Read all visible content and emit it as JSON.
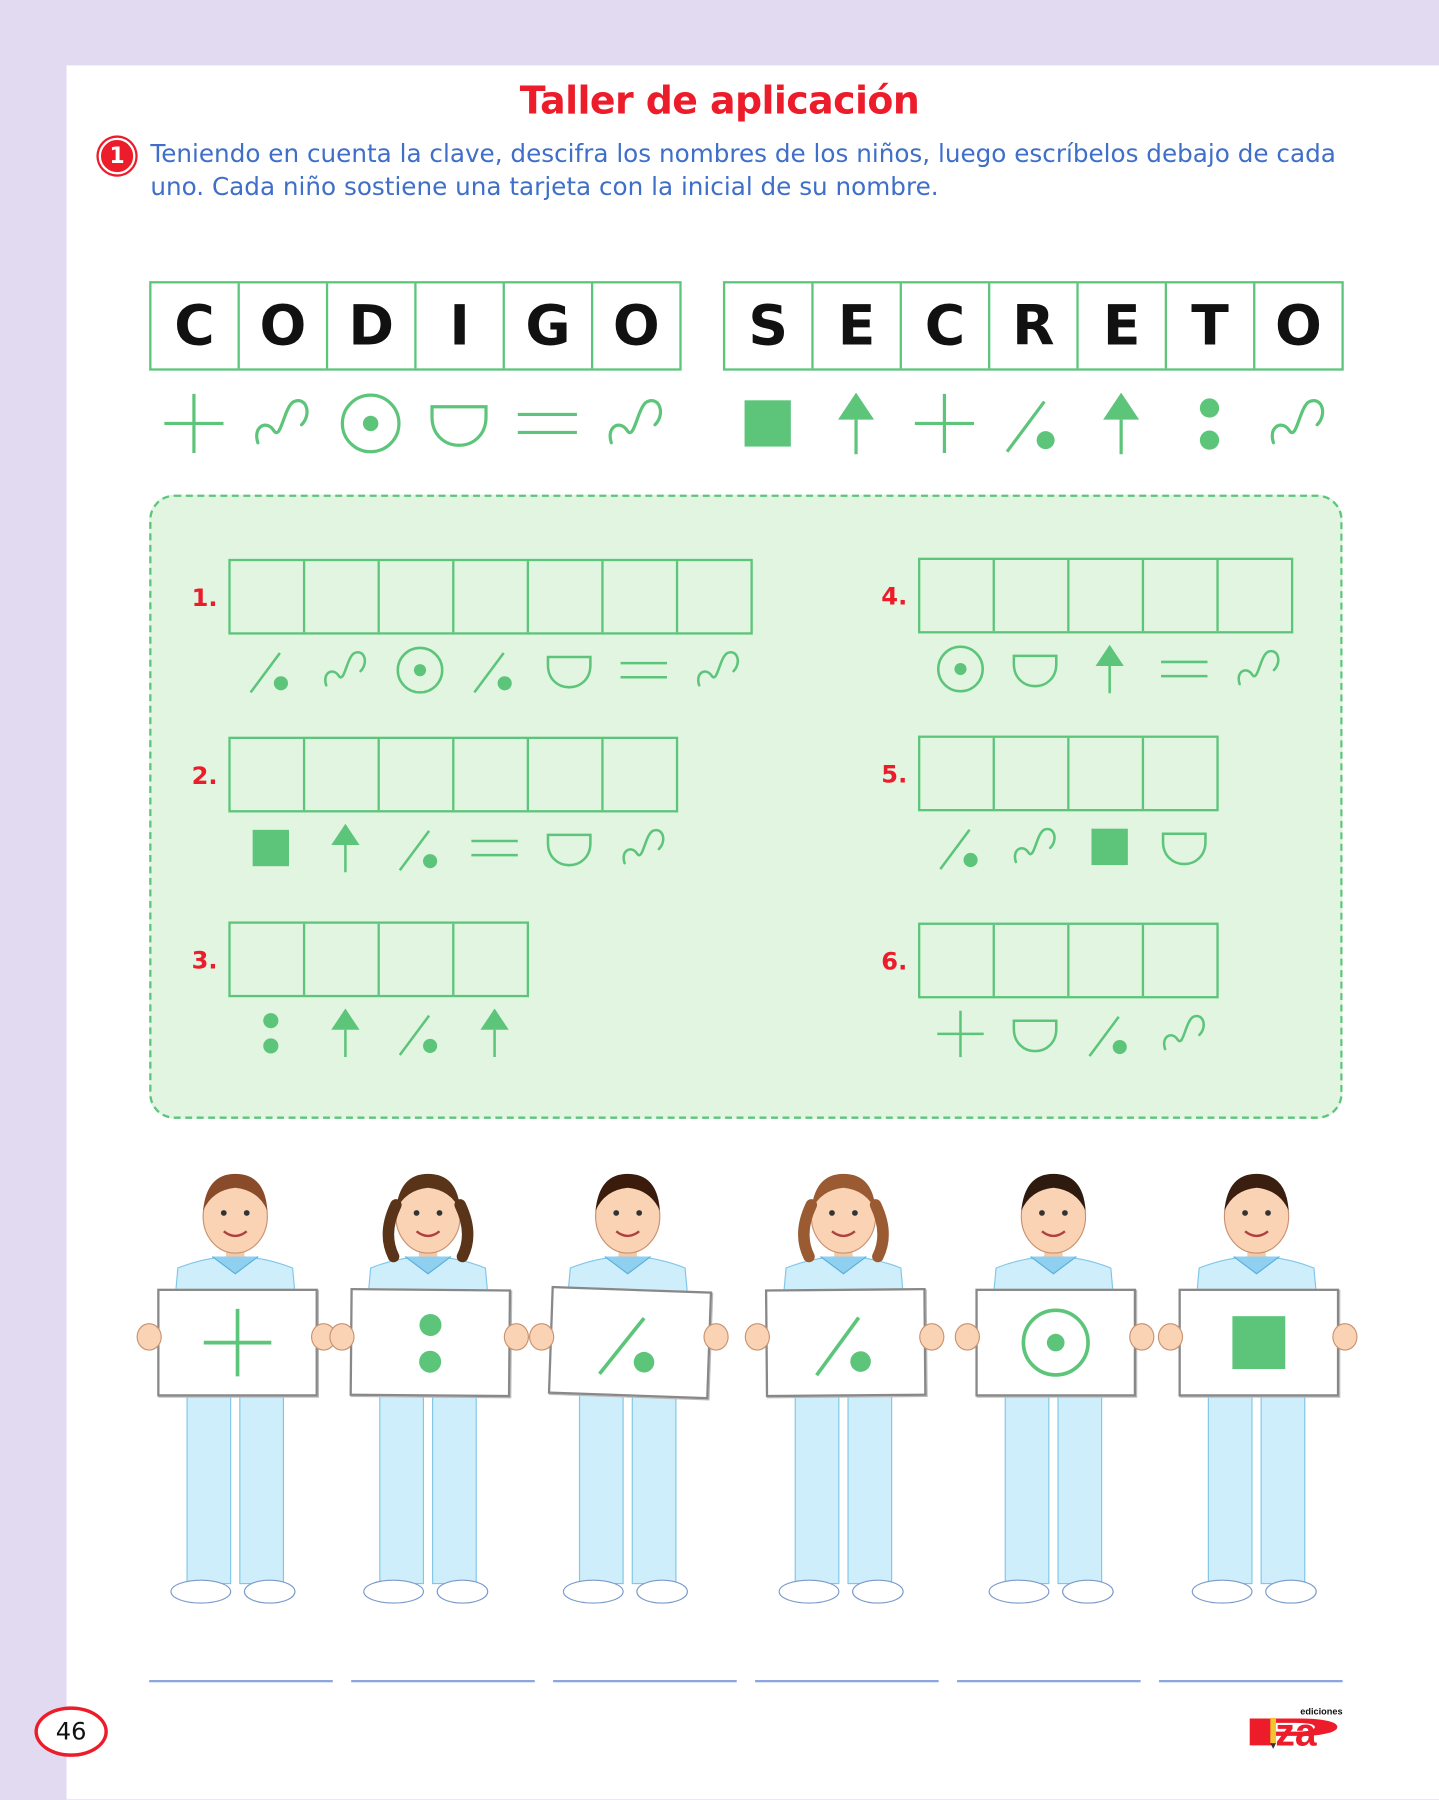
{
  "title": "Taller de aplicación",
  "activity": {
    "number": "1",
    "instruction": "Teniendo en cuenta la clave, descifra los nombres de los niños, luego escríbelos debajo de cada uno. Cada niño sostiene una tarjeta con la inicial de su nombre."
  },
  "code": {
    "word1": [
      {
        "letter": "C",
        "symbol": "plus"
      },
      {
        "letter": "O",
        "symbol": "s-curve"
      },
      {
        "letter": "D",
        "symbol": "circled-dot"
      },
      {
        "letter": "I",
        "symbol": "bowl"
      },
      {
        "letter": "G",
        "symbol": "double-line"
      },
      {
        "letter": "O",
        "symbol": "s-curve"
      }
    ],
    "word2": [
      {
        "letter": "S",
        "symbol": "square"
      },
      {
        "letter": "E",
        "symbol": "arrow-up"
      },
      {
        "letter": "C",
        "symbol": "plus"
      },
      {
        "letter": "R",
        "symbol": "slash-dot"
      },
      {
        "letter": "E",
        "symbol": "arrow-up"
      },
      {
        "letter": "T",
        "symbol": "colon"
      },
      {
        "letter": "O",
        "symbol": "s-curve"
      }
    ]
  },
  "exercises": [
    {
      "label": "1.",
      "symbols": [
        "slash-dot",
        "s-curve",
        "circled-dot",
        "slash-dot",
        "bowl",
        "double-line",
        "s-curve"
      ]
    },
    {
      "label": "2.",
      "symbols": [
        "square",
        "arrow-up",
        "slash-dot",
        "double-line",
        "bowl",
        "s-curve"
      ]
    },
    {
      "label": "3.",
      "symbols": [
        "colon",
        "arrow-up",
        "slash-dot",
        "arrow-up"
      ]
    },
    {
      "label": "4.",
      "symbols": [
        "circled-dot",
        "bowl",
        "arrow-up",
        "double-line",
        "s-curve"
      ]
    },
    {
      "label": "5.",
      "symbols": [
        "slash-dot",
        "s-curve",
        "square",
        "bowl"
      ]
    },
    {
      "label": "6.",
      "symbols": [
        "plus",
        "bowl",
        "slash-dot",
        "s-curve"
      ]
    }
  ],
  "kids": [
    {
      "gender": "boy",
      "card": "plus",
      "hair": "#8a4b2a"
    },
    {
      "gender": "girl",
      "card": "colon",
      "hair": "#5a3418"
    },
    {
      "gender": "boy",
      "card": "slash-dot",
      "hair": "#3b1c0c"
    },
    {
      "gender": "girl",
      "card": "slash-dot",
      "hair": "#9a5a32"
    },
    {
      "gender": "boy",
      "card": "circled-dot",
      "hair": "#2e1a0e"
    },
    {
      "gender": "boy",
      "card": "square",
      "hair": "#3a1e10"
    }
  ],
  "page_number": "46",
  "logo": {
    "text": "Piza",
    "subtext": "ediciones"
  },
  "colors": {
    "green": "#5cc57a",
    "red": "#ec1c2a",
    "blue": "#3f6fc8"
  }
}
